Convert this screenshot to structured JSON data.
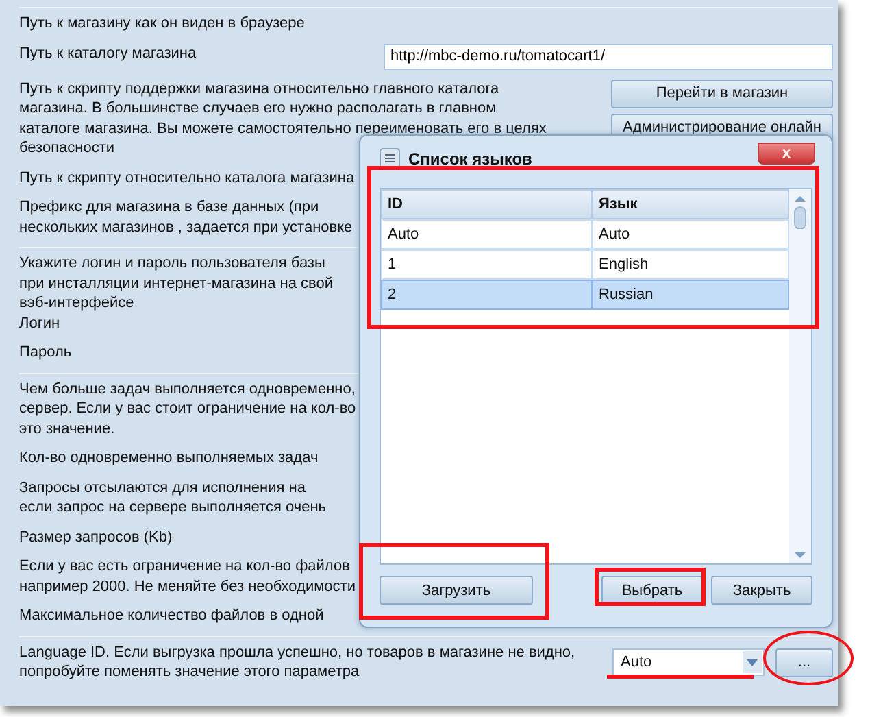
{
  "sections": [
    {
      "rows": [
        {
          "lines": [
            "Путь к магазину как он виден в браузере"
          ]
        },
        {
          "lines": [
            "Путь к каталогу магазина"
          ],
          "controls": [
            {
              "kind": "input",
              "value": "http://mbc-demo.ru/tomatocart1/"
            }
          ]
        },
        {
          "lines": [
            "Путь к скрипту поддержки магазина относительно главного каталога",
            "магазина. В большинстве случаев его нужно располагать в главном",
            "каталоге магазина. Вы можете самостоятельно переименовать его в целях",
            "безопасности"
          ],
          "controls": [
            {
              "kind": "button",
              "label": "Перейти в магазин"
            },
            {
              "kind": "button",
              "label": "Администрирование онлайн"
            }
          ]
        },
        {
          "lines": [
            "Путь к скрипту относительно каталога магазина"
          ]
        },
        {
          "lines": [
            "Префикс для магазина в базе данных (при",
            "нескольких магазинов , задается при установке"
          ]
        }
      ]
    },
    {
      "rows": [
        {
          "lines": [
            "Укажите логин и пароль пользователя базы",
            "при инсталляции интернет-магазина на свой",
            "вэб-интерфейсе",
            "Логин"
          ]
        },
        {
          "lines": [
            "Пароль"
          ]
        }
      ]
    },
    {
      "rows": [
        {
          "lines": [
            "Чем больше задач выполняется одновременно,",
            "сервер. Если у вас стоит ограничение на кол-во",
            "это значение."
          ]
        },
        {
          "lines": [
            "Кол-во одновременно выполняемых задач"
          ]
        },
        {
          "lines": [
            "Запросы отсылаются для исполнения на",
            "если запрос на сервере выполняется очень"
          ]
        },
        {
          "lines": [
            "Размер запросов (Kb)"
          ]
        },
        {
          "lines": [
            "Если у вас есть ограничение на кол-во файлов",
            "например 2000. Не меняйте без необходимости"
          ]
        },
        {
          "lines": [
            "Максимальное количество файлов в одной"
          ]
        }
      ]
    },
    {
      "rows": [
        {
          "lines": [
            "Language ID. Если выгрузка прошла успешно, но товаров в магазине не видно,",
            "попробуйте поменять значение этого параметра"
          ],
          "controls": [
            {
              "kind": "select",
              "value": "Auto"
            },
            {
              "kind": "button",
              "label": "..."
            }
          ]
        }
      ]
    }
  ],
  "dialog": {
    "title": "Список языков",
    "table": {
      "columns": [
        "ID",
        "Язык"
      ],
      "rows": [
        {
          "cells": [
            "Auto",
            "Auto"
          ],
          "selected": false
        },
        {
          "cells": [
            "1",
            "English"
          ],
          "selected": false
        },
        {
          "cells": [
            "2",
            "Russian"
          ],
          "selected": true
        }
      ]
    },
    "close": "x",
    "buttons": [
      "Загрузить",
      "Выбрать",
      "Закрыть"
    ]
  }
}
